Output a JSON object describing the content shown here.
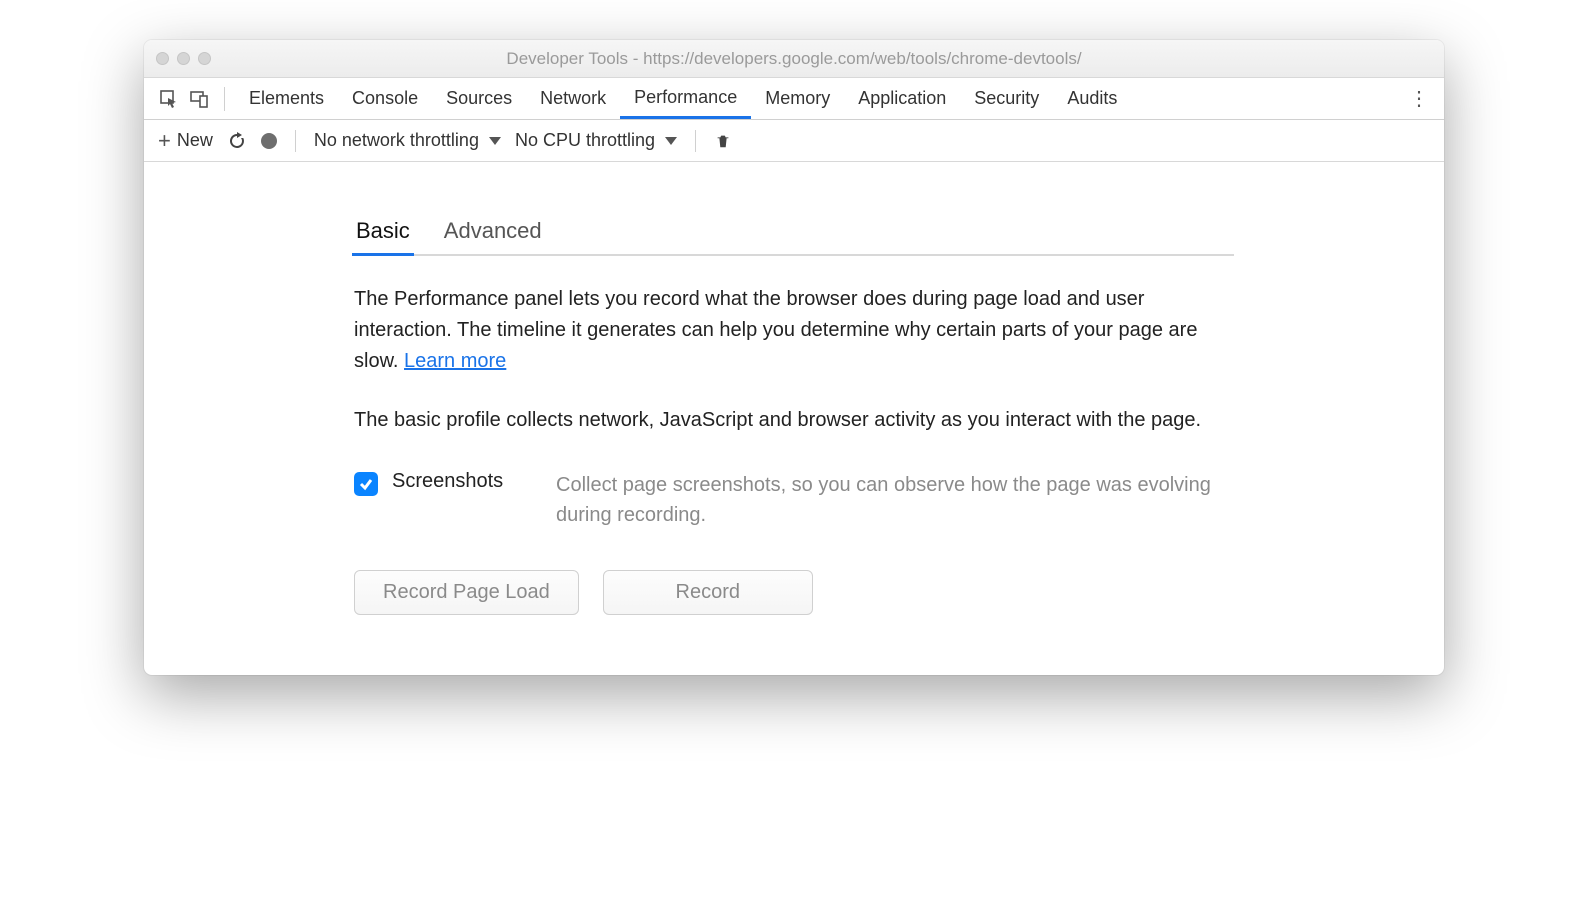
{
  "window": {
    "title": "Developer Tools - https://developers.google.com/web/tools/chrome-devtools/"
  },
  "main_tabs": {
    "items": [
      "Elements",
      "Console",
      "Sources",
      "Network",
      "Performance",
      "Memory",
      "Application",
      "Security",
      "Audits"
    ],
    "active": "Performance"
  },
  "toolbar": {
    "new_label": "New",
    "network_throttling": "No network throttling",
    "cpu_throttling": "No CPU throttling"
  },
  "subtabs": {
    "items": [
      "Basic",
      "Advanced"
    ],
    "active": "Basic"
  },
  "body": {
    "intro": "The Performance panel lets you record what the browser does during page load and user interaction. The timeline it generates can help you determine why certain parts of your page are slow.  ",
    "learn_more": "Learn more",
    "basic_desc": "The basic profile collects network, JavaScript and browser activity as you interact with the page."
  },
  "option": {
    "label": "Screenshots",
    "description": "Collect page screenshots, so you can observe how the page was evolving during recording.",
    "checked": true
  },
  "buttons": {
    "record_page_load": "Record Page Load",
    "record": "Record"
  }
}
